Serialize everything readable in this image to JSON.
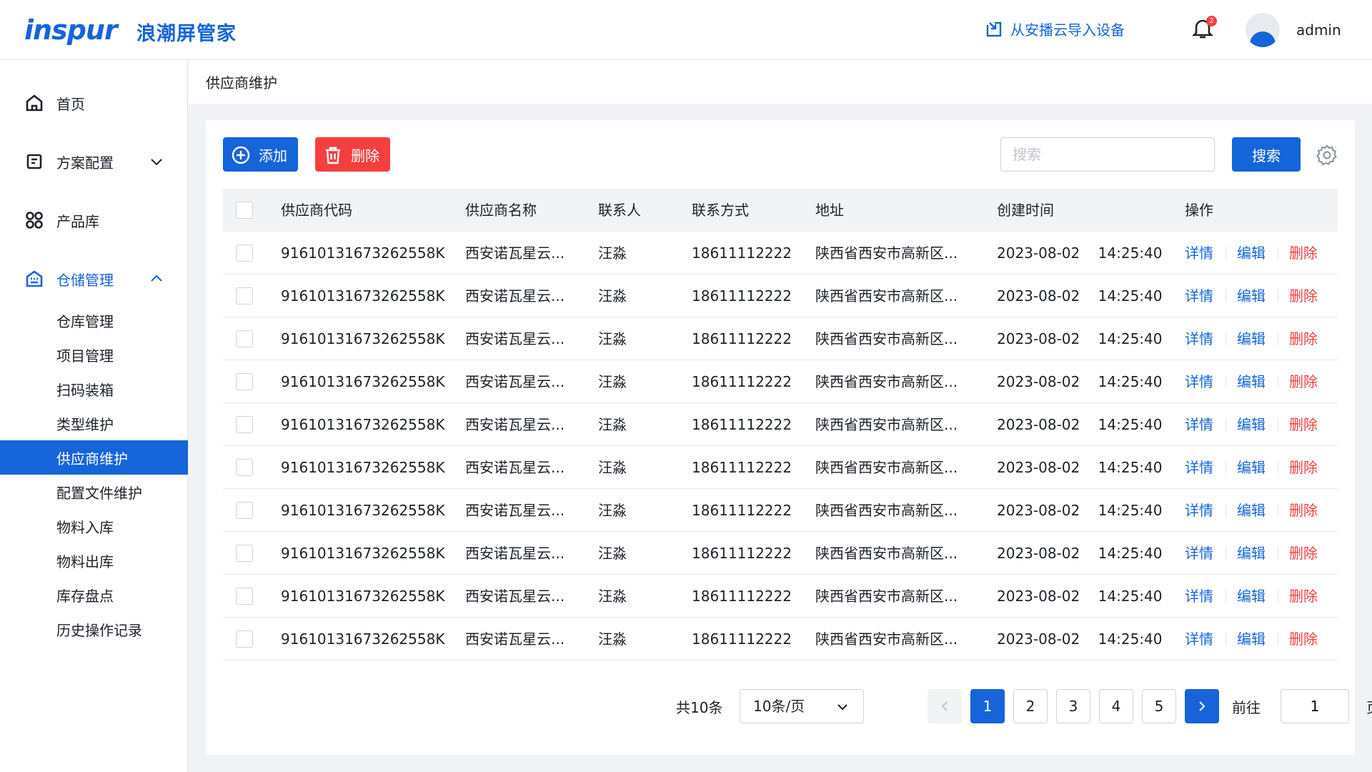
{
  "header": {
    "logo_text": "inspur",
    "app_name": "浪潮屏管家",
    "import_label": "从安播云导入设备",
    "notification_count": "2",
    "username": "admin"
  },
  "sidebar": {
    "items": [
      {
        "label": "首页",
        "icon": "home-icon"
      },
      {
        "label": "方案配置",
        "icon": "document-icon"
      },
      {
        "label": "产品库",
        "icon": "grid-icon"
      },
      {
        "label": "仓储管理",
        "icon": "warehouse-icon"
      }
    ],
    "sub_items": [
      "仓库管理",
      "项目管理",
      "扫码装箱",
      "类型维护",
      "供应商维护",
      "配置文件维护",
      "物料入库",
      "物料出库",
      "库存盘点",
      "历史操作记录"
    ],
    "selected_sub_item": "供应商维护"
  },
  "breadcrumb": "供应商维护",
  "toolbar": {
    "add_label": "添加",
    "delete_label": "删除",
    "search_placeholder": "搜索",
    "search_button": "搜索"
  },
  "table": {
    "headers": [
      "供应商代码",
      "供应商名称",
      "联系人",
      "联系方式",
      "地址",
      "创建时间",
      "操作"
    ],
    "ops": {
      "detail": "详情",
      "edit": "编辑",
      "delete": "删除"
    },
    "rows": [
      {
        "code": "91610131673262558K",
        "name": "西安诺瓦星云...",
        "contact": "汪淼",
        "phone": "18611112222",
        "address": "陕西省西安市高新区...",
        "created": "2023-08-02    14:25:40"
      },
      {
        "code": "91610131673262558K",
        "name": "西安诺瓦星云...",
        "contact": "汪淼",
        "phone": "18611112222",
        "address": "陕西省西安市高新区...",
        "created": "2023-08-02    14:25:40"
      },
      {
        "code": "91610131673262558K",
        "name": "西安诺瓦星云...",
        "contact": "汪淼",
        "phone": "18611112222",
        "address": "陕西省西安市高新区...",
        "created": "2023-08-02    14:25:40"
      },
      {
        "code": "91610131673262558K",
        "name": "西安诺瓦星云...",
        "contact": "汪淼",
        "phone": "18611112222",
        "address": "陕西省西安市高新区...",
        "created": "2023-08-02    14:25:40"
      },
      {
        "code": "91610131673262558K",
        "name": "西安诺瓦星云...",
        "contact": "汪淼",
        "phone": "18611112222",
        "address": "陕西省西安市高新区...",
        "created": "2023-08-02    14:25:40"
      },
      {
        "code": "91610131673262558K",
        "name": "西安诺瓦星云...",
        "contact": "汪淼",
        "phone": "18611112222",
        "address": "陕西省西安市高新区...",
        "created": "2023-08-02    14:25:40"
      },
      {
        "code": "91610131673262558K",
        "name": "西安诺瓦星云...",
        "contact": "汪淼",
        "phone": "18611112222",
        "address": "陕西省西安市高新区...",
        "created": "2023-08-02    14:25:40"
      },
      {
        "code": "91610131673262558K",
        "name": "西安诺瓦星云...",
        "contact": "汪淼",
        "phone": "18611112222",
        "address": "陕西省西安市高新区...",
        "created": "2023-08-02    14:25:40"
      },
      {
        "code": "91610131673262558K",
        "name": "西安诺瓦星云...",
        "contact": "汪淼",
        "phone": "18611112222",
        "address": "陕西省西安市高新区...",
        "created": "2023-08-02    14:25:40"
      },
      {
        "code": "91610131673262558K",
        "name": "西安诺瓦星云...",
        "contact": "汪淼",
        "phone": "18611112222",
        "address": "陕西省西安市高新区...",
        "created": "2023-08-02    14:25:40"
      }
    ]
  },
  "pagination": {
    "total": "共10条",
    "page_size": "10条/页",
    "pages": [
      "1",
      "2",
      "3",
      "4",
      "5"
    ],
    "current_page": "1",
    "goto_label": "前往",
    "goto_value": "1",
    "page_unit": "页"
  },
  "colors": {
    "primary": "#1664d9",
    "danger": "#f53f3f"
  }
}
